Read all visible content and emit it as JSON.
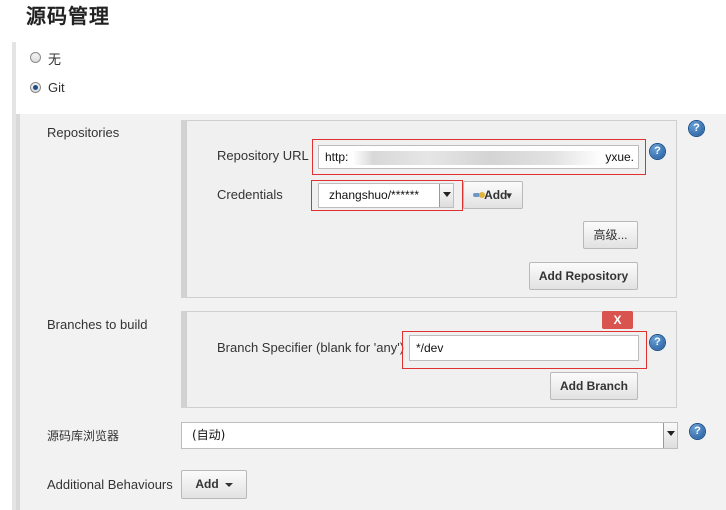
{
  "page": {
    "title": "源码管理"
  },
  "scm": {
    "options": [
      {
        "label": "无",
        "selected": false
      },
      {
        "label": "Git",
        "selected": true
      }
    ]
  },
  "repositories": {
    "label": "Repositories",
    "url_label": "Repository URL",
    "url_value_start": "http:",
    "url_value_end": "yxue.",
    "credentials_label": "Credentials",
    "credentials_value": "zhangshuo/******",
    "add_credentials_label": "Add",
    "advanced_label": "高级...",
    "add_repository_label": "Add Repository"
  },
  "branches": {
    "label": "Branches to build",
    "delete_label": "X",
    "specifier_label": "Branch Specifier (blank for 'any')",
    "specifier_value": "*/dev",
    "add_branch_label": "Add Branch"
  },
  "browser": {
    "label": "源码库浏览器",
    "value": "(自动)"
  },
  "behaviours": {
    "label": "Additional Behaviours",
    "add_label": "Add"
  },
  "help": {
    "symbol": "?"
  },
  "colors": {
    "highlight": "#e03030",
    "help": "#1f5a9a",
    "delete": "#d9534f"
  },
  "icons": [
    "help-icon",
    "key-icon",
    "caret-down-icon"
  ]
}
